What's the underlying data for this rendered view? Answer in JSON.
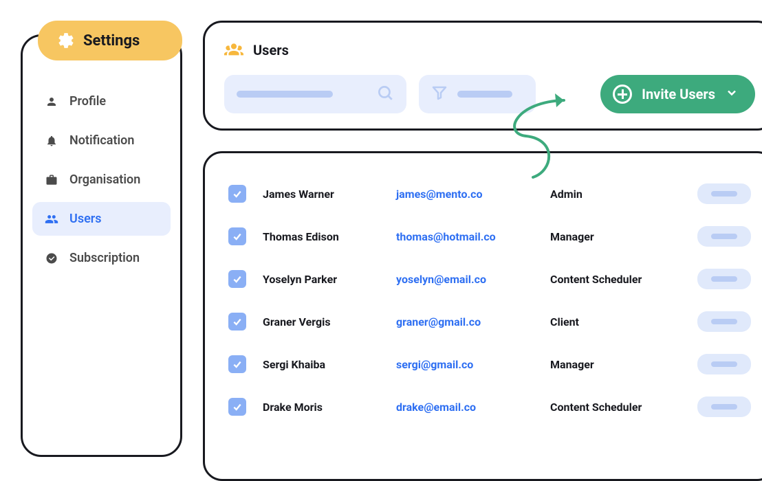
{
  "sidebar": {
    "title": "Settings",
    "items": [
      {
        "label": "Profile",
        "icon": "person-icon",
        "active": false
      },
      {
        "label": "Notification",
        "icon": "bell-icon",
        "active": false
      },
      {
        "label": "Organisation",
        "icon": "briefcase-icon",
        "active": false
      },
      {
        "label": "Users",
        "icon": "users-icon",
        "active": true
      },
      {
        "label": "Subscription",
        "icon": "check-circle-icon",
        "active": false
      }
    ]
  },
  "header": {
    "title": "Users",
    "invite_button_label": "Invite Users"
  },
  "users": [
    {
      "name": "James Warner",
      "email": "james@mento.co",
      "role": "Admin",
      "checked": true
    },
    {
      "name": "Thomas Edison",
      "email": "thomas@hotmail.co",
      "role": "Manager",
      "checked": true
    },
    {
      "name": "Yoselyn Parker",
      "email": "yoselyn@email.co",
      "role": "Content Scheduler",
      "checked": true
    },
    {
      "name": "Graner Vergis",
      "email": "graner@gmail.co",
      "role": "Client",
      "checked": true
    },
    {
      "name": "Sergi Khaiba",
      "email": "sergi@gmail.co",
      "role": "Manager",
      "checked": true
    },
    {
      "name": "Drake Moris",
      "email": "drake@email.co",
      "role": "Content Scheduler",
      "checked": true
    }
  ],
  "colors": {
    "accent_yellow": "#F7C661",
    "accent_blue": "#2E6FF2",
    "accent_green": "#3DAA7D",
    "panel_border": "#18191F",
    "pale_blue": "#E8EEFD"
  }
}
